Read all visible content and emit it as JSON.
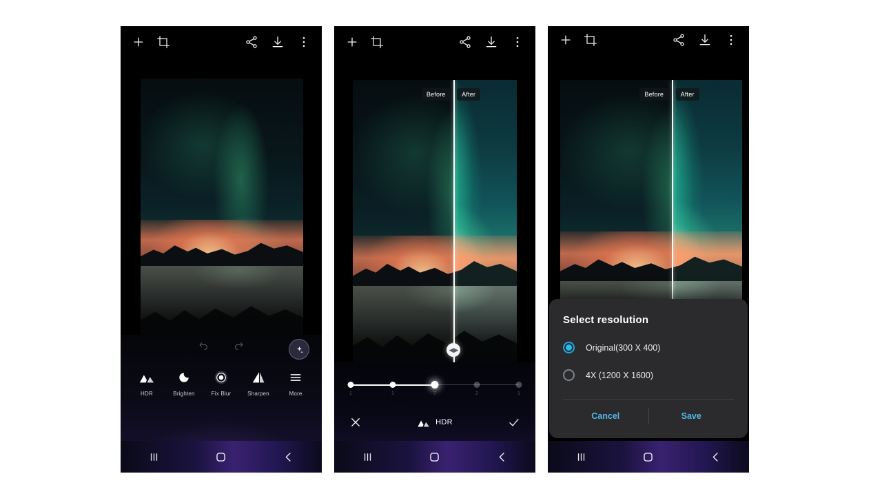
{
  "app": {
    "toolbar": {
      "add_label": "Add",
      "crop_label": "Crop",
      "share_label": "Share",
      "download_label": "Download",
      "more_label": "More options"
    }
  },
  "panel1": {
    "tools": [
      {
        "label": "HDR",
        "icon": "mountains-icon"
      },
      {
        "label": "Brighten",
        "icon": "moon-icon"
      },
      {
        "label": "Fix Blur",
        "icon": "focus-ring-icon"
      },
      {
        "label": "Sharpen",
        "icon": "triangle-icon"
      },
      {
        "label": "More",
        "icon": "hamburger-icon"
      }
    ],
    "undo_label": "Undo",
    "redo_label": "Redo",
    "auto_enhance_label": "Auto enhance"
  },
  "panel2": {
    "compare": {
      "before": "Before",
      "after": "After"
    },
    "slider": {
      "stops": [
        "1",
        "1",
        "7",
        "2",
        "1"
      ],
      "count": 5,
      "current_index": 3
    },
    "effect_label": "HDR",
    "cancel_label": "Cancel",
    "confirm_label": "Apply"
  },
  "panel3": {
    "compare": {
      "before": "Before",
      "after": "After"
    },
    "dialog": {
      "title": "Select resolution",
      "options": [
        {
          "label": "Original(300 X 400)",
          "selected": true
        },
        {
          "label": "4X (1200 X 1600)",
          "selected": false
        }
      ],
      "cancel_label": "Cancel",
      "save_label": "Save"
    }
  },
  "navbar": {
    "recents_label": "Recents",
    "home_label": "Home",
    "back_label": "Back"
  },
  "colors": {
    "accent_cyan": "#22c0f0",
    "dialog_action": "#4eb7e6",
    "dialog_bg": "#2b2b2e"
  }
}
